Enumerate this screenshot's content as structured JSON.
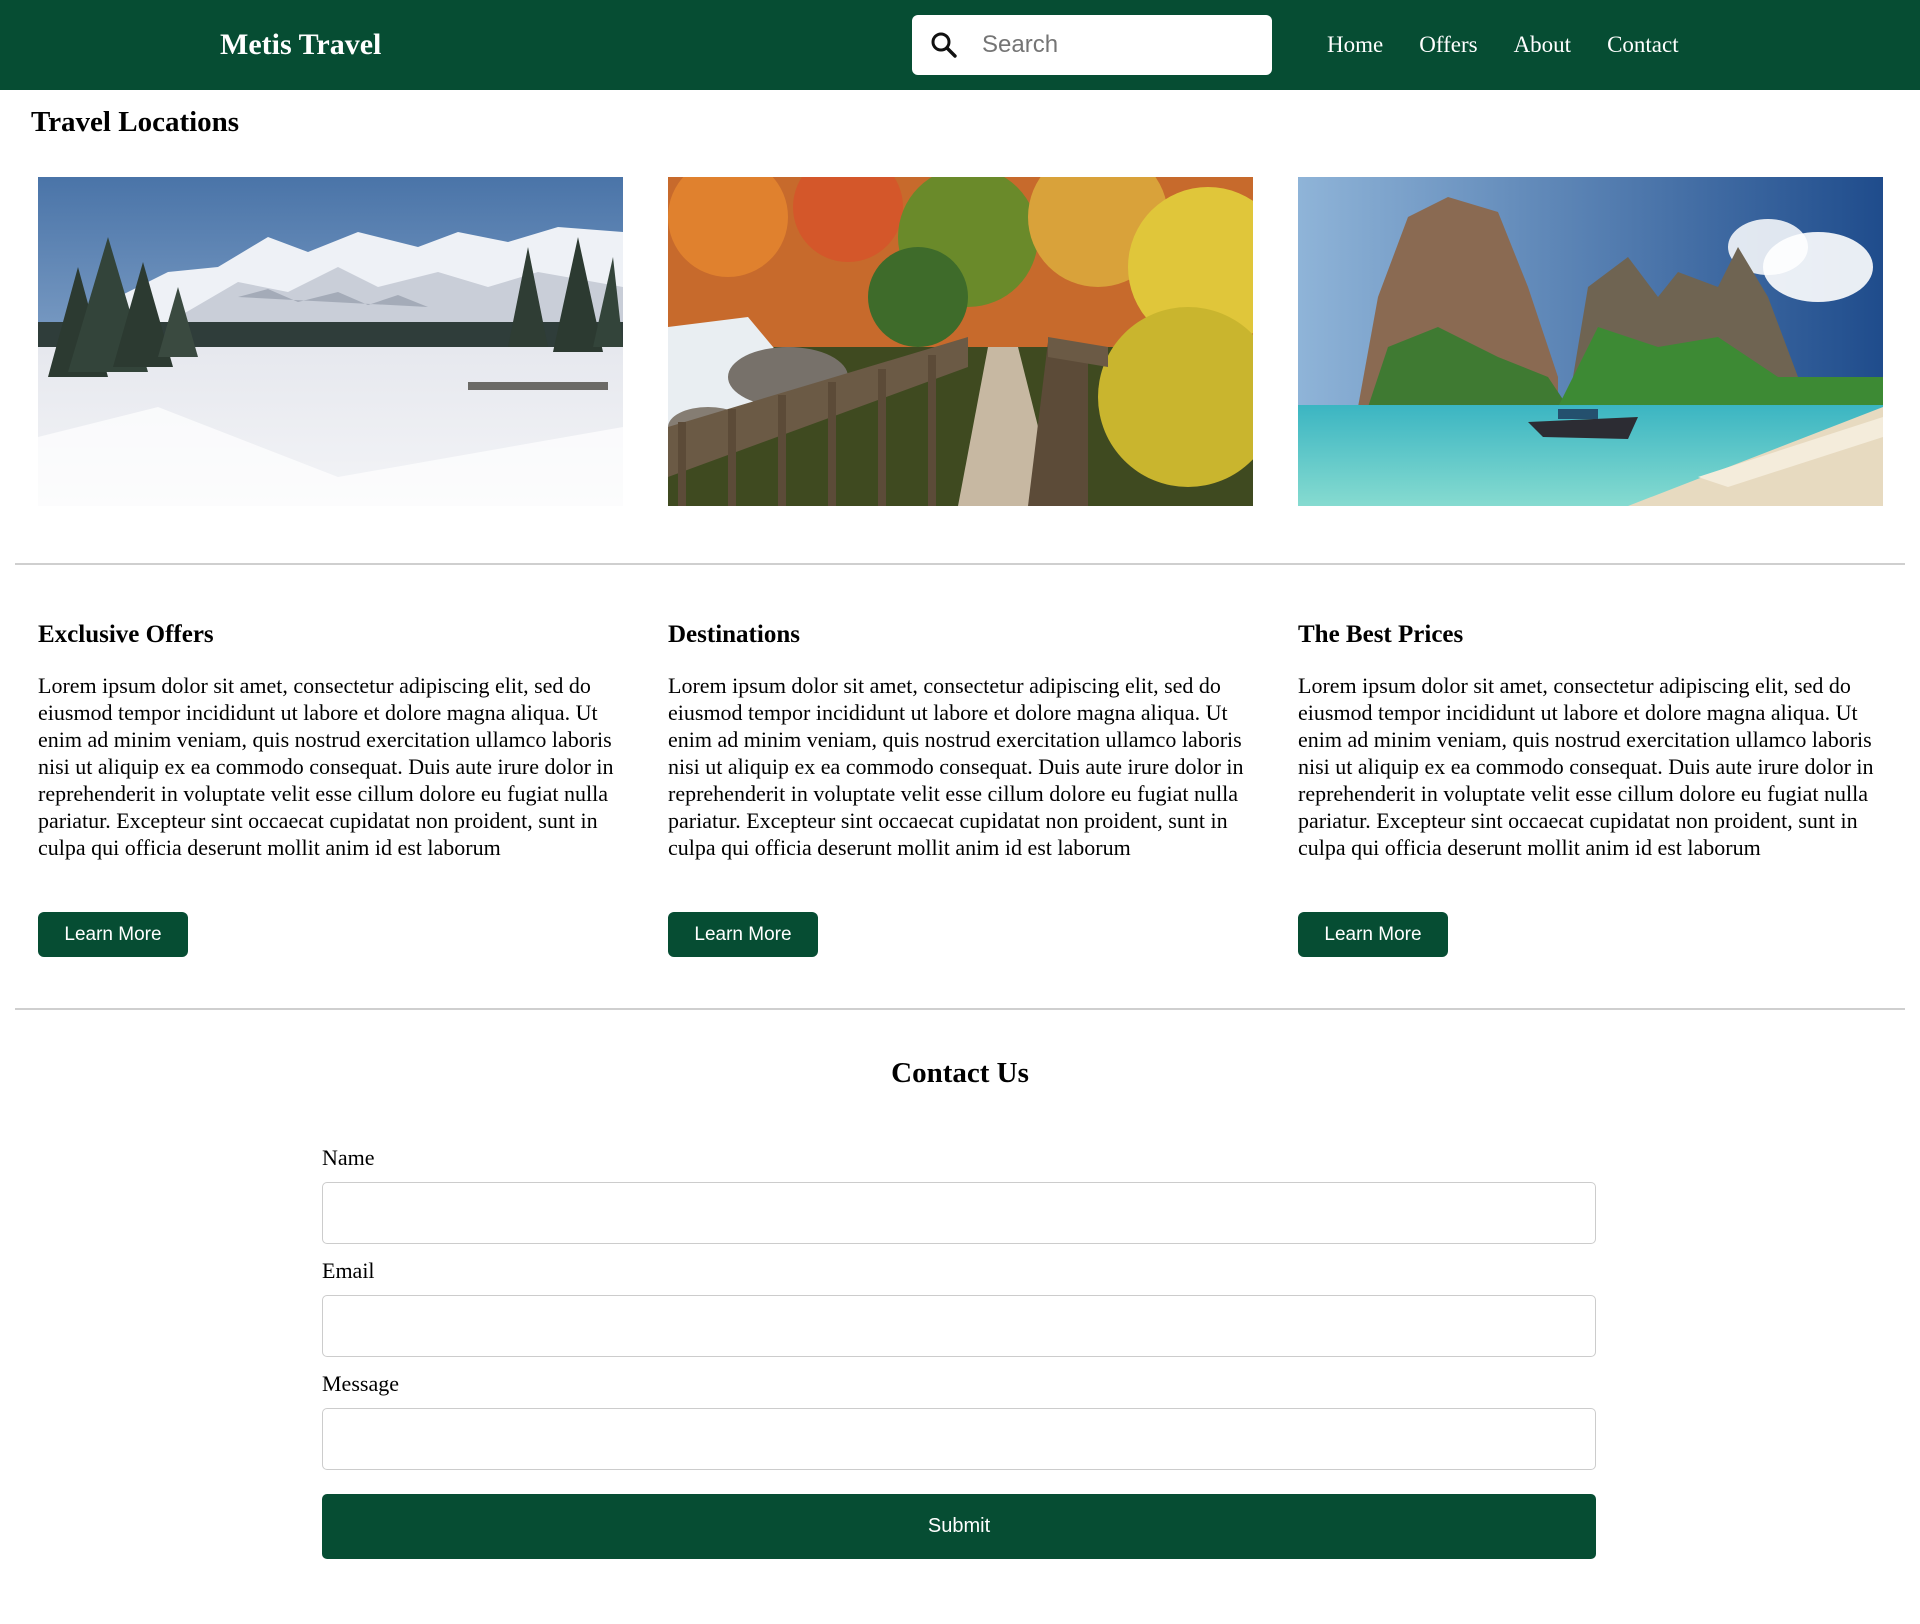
{
  "nav": {
    "brand": "Metis Travel",
    "search_placeholder": "Search",
    "links": [
      "Home",
      "Offers",
      "About",
      "Contact"
    ]
  },
  "locations": {
    "title": "Travel Locations",
    "photos": [
      {
        "alt": "Snowy mountain landscape"
      },
      {
        "alt": "Autumn forest boardwalk with stream"
      },
      {
        "alt": "Tropical beach with limestone cliffs and longtail boat"
      }
    ]
  },
  "features": [
    {
      "title": "Exclusive Offers",
      "body": "Lorem ipsum dolor sit amet, consectetur adipiscing elit, sed do eiusmod tempor incididunt ut labore et dolore magna aliqua. Ut enim ad minim veniam, quis nostrud exercitation ullamco laboris nisi ut aliquip ex ea commodo consequat. Duis aute irure dolor in reprehenderit in voluptate velit esse cillum dolore eu fugiat nulla pariatur. Excepteur sint occaecat cupidatat non proident, sunt in culpa qui officia deserunt mollit anim id est laborum",
      "button": "Learn More"
    },
    {
      "title": "Destinations",
      "body": "Lorem ipsum dolor sit amet, consectetur adipiscing elit, sed do eiusmod tempor incididunt ut labore et dolore magna aliqua. Ut enim ad minim veniam, quis nostrud exercitation ullamco laboris nisi ut aliquip ex ea commodo consequat. Duis aute irure dolor in reprehenderit in voluptate velit esse cillum dolore eu fugiat nulla pariatur. Excepteur sint occaecat cupidatat non proident, sunt in culpa qui officia deserunt mollit anim id est laborum",
      "button": "Learn More"
    },
    {
      "title": "The Best Prices",
      "body": "Lorem ipsum dolor sit amet, consectetur adipiscing elit, sed do eiusmod tempor incididunt ut labore et dolore magna aliqua. Ut enim ad minim veniam, quis nostrud exercitation ullamco laboris nisi ut aliquip ex ea commodo consequat. Duis aute irure dolor in reprehenderit in voluptate velit esse cillum dolore eu fugiat nulla pariatur. Excepteur sint occaecat cupidatat non proident, sunt in culpa qui officia deserunt mollit anim id est laborum",
      "button": "Learn More"
    }
  ],
  "contact": {
    "title": "Contact Us",
    "fields": [
      {
        "label": "Name",
        "value": ""
      },
      {
        "label": "Email",
        "value": ""
      },
      {
        "label": "Message",
        "value": ""
      }
    ],
    "submit": "Submit"
  },
  "colors": {
    "brand_green": "#064d33",
    "divider": "#cfcfcf",
    "input_border": "#cccccc"
  }
}
